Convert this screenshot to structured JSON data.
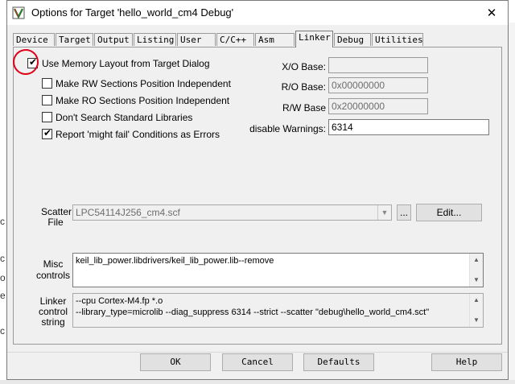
{
  "window": {
    "title": "Options for Target 'hello_world_cm4 Debug'",
    "close_label": "✕"
  },
  "tabs": [
    {
      "label": "Device",
      "active": false
    },
    {
      "label": "Target",
      "active": false
    },
    {
      "label": "Output",
      "active": false
    },
    {
      "label": "Listing",
      "active": false
    },
    {
      "label": "User",
      "active": false
    },
    {
      "label": "C/C++",
      "active": false
    },
    {
      "label": "Asm",
      "active": false
    },
    {
      "label": "Linker",
      "active": true
    },
    {
      "label": "Debug",
      "active": false
    },
    {
      "label": "Utilities",
      "active": false
    }
  ],
  "options": {
    "use_memory_layout": {
      "label": "Use Memory Layout from Target Dialog",
      "checked": true
    },
    "rw_independent": {
      "label": "Make RW Sections Position Independent",
      "checked": false
    },
    "ro_independent": {
      "label": "Make RO Sections Position Independent",
      "checked": false
    },
    "dont_search_libs": {
      "label": "Don't Search Standard Libraries",
      "checked": false
    },
    "might_fail_errors": {
      "label": "Report 'might fail' Conditions as Errors",
      "checked": true
    },
    "check_mark": "✔"
  },
  "bases": {
    "xo_label": "X/O Base:",
    "xo_value": "",
    "ro_label": "R/O Base:",
    "ro_value": "0x00000000",
    "rw_label": "R/W Base",
    "rw_value": "0x20000000",
    "warnings_label": "disable Warnings:",
    "warnings_value": "6314"
  },
  "scatter": {
    "label_line1": "Scatter",
    "label_line2": "File",
    "value": "LPC54114J256_cm4.scf",
    "browse_label": "...",
    "edit_label": "Edit..."
  },
  "misc": {
    "label_line1": "Misc",
    "label_line2": "controls",
    "value": "keil_lib_power.libdrivers/keil_lib_power.lib--remove"
  },
  "linker_string": {
    "label_line1": "Linker",
    "label_line2": "control",
    "label_line3": "string",
    "line1": "--cpu Cortex-M4.fp *.o",
    "line2": "--library_type=microlib --diag_suppress 6314 --strict --scatter \"debug\\hello_world_cm4.sct\""
  },
  "footer": {
    "ok_label": "OK",
    "cancel_label": "Cancel",
    "defaults_label": "Defaults",
    "help_label": "Help"
  },
  "background_glyphs": [
    "c",
    "c",
    "o",
    "e",
    "c"
  ],
  "colors": {
    "annotation_red": "#e0001a",
    "dialog_bg": "#f0f0f0",
    "keil_icon_green": "#2e7d32"
  },
  "icons": {
    "app": "keil-uvision-icon",
    "close": "close-icon",
    "dropdown": "chevron-down-icon",
    "scroll_up": "scroll-up-arrow-icon",
    "scroll_down": "scroll-down-arrow-icon"
  }
}
